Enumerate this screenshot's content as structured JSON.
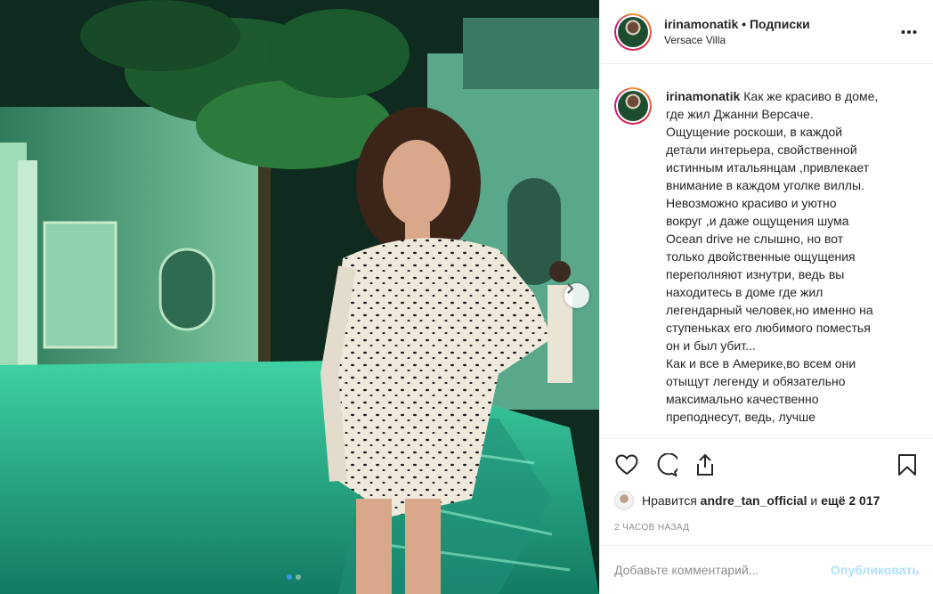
{
  "post": {
    "username": "irinamonatik",
    "separator": "•",
    "follow_label": "Подписки",
    "location": "Versace Villa",
    "more_icon": "more-horizontal-icon"
  },
  "caption": {
    "username": "irinamonatik",
    "text": "Как же красиво в доме,\nгде жил Джанни Версаче.\nОщущение роскоши, в каждой\nдетали интерьера, свойственной\nистинным итальянцам ,привлекает\nвнимание в каждом уголке виллы.\nНевозможно красиво и уютно\nвокруг ,и даже ощущения шума\nOcean drive не слышно, но вот\nтолько двойственные ощущения\nпереполняют изнутри, ведь вы\nнаходитесь в доме где жил\nлегендарный человек,но именно на\nступеньках его любимого поместья\nон и был убит...\nКак и все в Америке,во всем они\nотыщут легенду и обязательно\nмаксимально качественно\nпреподнесут, ведь, лучше"
  },
  "actions": {
    "like_icon": "heart-icon",
    "comment_icon": "comment-icon",
    "share_icon": "share-icon",
    "save_icon": "bookmark-icon"
  },
  "likes": {
    "prefix": "Нравится",
    "user": "andre_tan_official",
    "conjunction": "и",
    "others": "ещё 2 017"
  },
  "timestamp": "2 часов назад",
  "comment": {
    "placeholder": "Добавьте комментарий...",
    "publish_label": "Опубликовать"
  },
  "carousel": {
    "total_slides": 2,
    "active_slide": 1
  },
  "colors": {
    "accent": "#3897f0",
    "publish_disabled": "#b2dffc",
    "muted": "#8e8e8e",
    "text": "#262626"
  }
}
